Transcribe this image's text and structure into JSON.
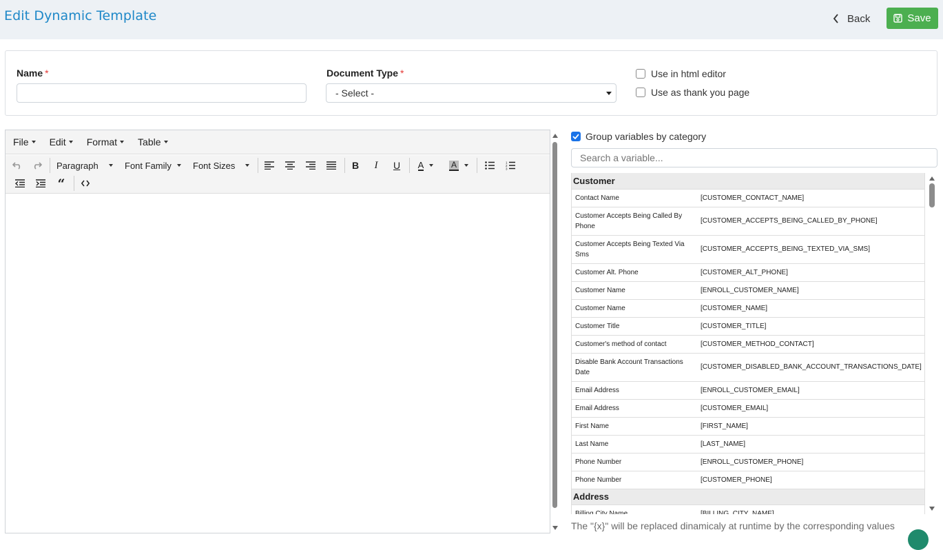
{
  "header": {
    "title": "Edit Dynamic Template",
    "back_label": "Back",
    "save_label": "Save"
  },
  "form": {
    "name_label": "Name",
    "name_value": "",
    "doc_type_label": "Document Type",
    "doc_type_selected": "- Select -",
    "required_mark": "*",
    "checkbox_html_editor": "Use in html editor",
    "checkbox_thank_you": "Use as thank you page"
  },
  "editor": {
    "menus": [
      "File",
      "Edit",
      "Format",
      "Table"
    ],
    "block_format": "Paragraph",
    "font_family": "Font Family",
    "font_sizes": "Font Sizes",
    "content": ""
  },
  "variables": {
    "group_label": "Group variables by category",
    "group_checked": true,
    "search_placeholder": "Search a variable...",
    "categories": [
      {
        "name": "Customer",
        "rows": [
          {
            "label": "Contact Name",
            "token": "[CUSTOMER_CONTACT_NAME]"
          },
          {
            "label": "Customer Accepts Being Called By Phone",
            "token": "[CUSTOMER_ACCEPTS_BEING_CALLED_BY_PHONE]"
          },
          {
            "label": "Customer Accepts Being Texted Via Sms",
            "token": "[CUSTOMER_ACCEPTS_BEING_TEXTED_VIA_SMS]"
          },
          {
            "label": "Customer Alt. Phone",
            "token": "[CUSTOMER_ALT_PHONE]"
          },
          {
            "label": "Customer Name",
            "token": "[ENROLL_CUSTOMER_NAME]"
          },
          {
            "label": "Customer Name",
            "token": "[CUSTOMER_NAME]"
          },
          {
            "label": "Customer Title",
            "token": "[CUSTOMER_TITLE]"
          },
          {
            "label": "Customer's method of contact",
            "token": "[CUSTOMER_METHOD_CONTACT]"
          },
          {
            "label": "Disable Bank Account Transactions Date",
            "token": "[CUSTOMER_DISABLED_BANK_ACCOUNT_TRANSACTIONS_DATE]"
          },
          {
            "label": "Email Address",
            "token": "[ENROLL_CUSTOMER_EMAIL]"
          },
          {
            "label": "Email Address",
            "token": "[CUSTOMER_EMAIL]"
          },
          {
            "label": "First Name",
            "token": "[FIRST_NAME]"
          },
          {
            "label": "Last Name",
            "token": "[LAST_NAME]"
          },
          {
            "label": "Phone Number",
            "token": "[ENROLL_CUSTOMER_PHONE]"
          },
          {
            "label": "Phone Number",
            "token": "[CUSTOMER_PHONE]"
          }
        ]
      },
      {
        "name": "Address",
        "rows": [
          {
            "label": "Billing City Name",
            "token": "[BILLING_CITY_NAME]"
          }
        ]
      }
    ],
    "footnote": "The \"{x}\" will be replaced dinamicaly at runtime by the corresponding values"
  },
  "colors": {
    "title": "#1e88c8",
    "save_button": "#4caf50",
    "checkbox_checked": "#1a73e8"
  }
}
